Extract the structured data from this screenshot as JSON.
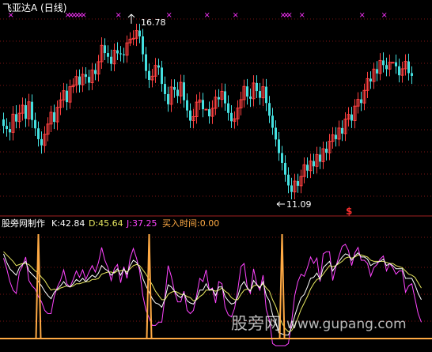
{
  "title": "飞亚达A (日线)",
  "price_panel": {
    "high_label": "16.78",
    "low_label": "11.09",
    "signal_glyph": "$",
    "marker_glyph": "×",
    "marker_color": "#ff33ff",
    "up_color": "#ff4040",
    "down_color": "#44e0e0"
  },
  "indicator_panel": {
    "source": "股旁网制作",
    "k_label": "K:42.84",
    "d_label": "D:45.64",
    "j_label": "J:37.25",
    "buy_label": "买入时间:0.00",
    "k_color": "#ffffff",
    "d_color": "#e8e860",
    "j_color": "#ff44ff",
    "buy_color": "#ffaa44"
  },
  "watermark": {
    "cn": "股旁网",
    "url": "www.gupang.com"
  },
  "chart_data": {
    "type": "candlestick",
    "price_high": 16.78,
    "price_low": 11.09,
    "marker_bars": [
      2,
      20,
      21,
      22,
      23,
      24,
      25,
      36,
      52,
      64,
      73,
      88,
      89,
      90,
      94,
      113,
      120
    ],
    "candles": [
      [
        13.68,
        13.47,
        13.9,
        13.23
      ],
      [
        13.47,
        13.37,
        13.72,
        13.12
      ],
      [
        13.37,
        13.26,
        13.6,
        13.0
      ],
      [
        13.26,
        13.85,
        14.11,
        13.0
      ],
      [
        13.85,
        13.61,
        14.14,
        13.39
      ],
      [
        13.61,
        13.88,
        14.16,
        13.39
      ],
      [
        13.88,
        14.14,
        14.39,
        13.64
      ],
      [
        14.14,
        13.7,
        14.36,
        13.43
      ],
      [
        13.7,
        14.25,
        14.51,
        13.45
      ],
      [
        14.25,
        13.66,
        14.49,
        13.4
      ],
      [
        13.66,
        13.39,
        13.9,
        13.14
      ],
      [
        13.39,
        13.04,
        13.61,
        12.8
      ],
      [
        13.04,
        12.84,
        13.29,
        12.57
      ],
      [
        12.84,
        13.2,
        13.46,
        12.6
      ],
      [
        13.2,
        13.53,
        13.75,
        12.97
      ],
      [
        13.53,
        13.91,
        14.12,
        13.27
      ],
      [
        13.91,
        13.6,
        14.16,
        13.37
      ],
      [
        13.6,
        14.07,
        14.29,
        13.33
      ],
      [
        14.07,
        14.31,
        14.56,
        13.82
      ],
      [
        14.31,
        14.61,
        14.86,
        14.06
      ],
      [
        14.61,
        14.24,
        14.84,
        13.98
      ],
      [
        14.24,
        14.74,
        14.97,
        14.02
      ],
      [
        14.74,
        14.79,
        15.01,
        14.53
      ],
      [
        14.79,
        15.07,
        15.29,
        14.54
      ],
      [
        15.07,
        14.8,
        15.3,
        14.55
      ],
      [
        14.8,
        15.14,
        15.38,
        14.57
      ],
      [
        15.14,
        15.06,
        15.37,
        14.84
      ],
      [
        15.06,
        14.87,
        15.29,
        14.62
      ],
      [
        14.87,
        15.28,
        15.51,
        14.63
      ],
      [
        15.28,
        15.15,
        15.49,
        14.95
      ],
      [
        15.15,
        15.55,
        15.77,
        14.91
      ],
      [
        15.55,
        16.08,
        16.34,
        15.32
      ],
      [
        16.08,
        15.83,
        16.31,
        15.6
      ],
      [
        15.83,
        15.71,
        16.08,
        15.5
      ],
      [
        15.71,
        15.48,
        15.94,
        15.25
      ],
      [
        15.48,
        15.92,
        16.14,
        15.24
      ],
      [
        15.92,
        15.82,
        16.18,
        15.6
      ],
      [
        15.82,
        15.79,
        16.06,
        15.56
      ],
      [
        15.79,
        15.76,
        16.0,
        15.51
      ],
      [
        15.76,
        16.16,
        16.4,
        15.52
      ],
      [
        16.16,
        16.28,
        16.5,
        16.06
      ],
      [
        16.28,
        16.31,
        16.57,
        16.08
      ],
      [
        16.31,
        16.56,
        16.78,
        16.06
      ],
      [
        16.56,
        16.37,
        16.78,
        16.15
      ],
      [
        16.37,
        15.79,
        16.61,
        15.55
      ],
      [
        15.79,
        15.25,
        16.03,
        15.0
      ],
      [
        15.25,
        14.96,
        15.49,
        14.7
      ],
      [
        14.96,
        15.08,
        15.32,
        14.72
      ],
      [
        15.08,
        15.43,
        15.67,
        14.86
      ],
      [
        15.43,
        15.36,
        15.65,
        15.12
      ],
      [
        15.36,
        14.83,
        15.58,
        14.58
      ],
      [
        14.83,
        14.5,
        15.07,
        14.27
      ],
      [
        14.5,
        14.17,
        14.74,
        13.93
      ],
      [
        14.17,
        14.73,
        14.98,
        13.92
      ],
      [
        14.73,
        14.64,
        14.98,
        14.38
      ],
      [
        14.64,
        14.44,
        14.89,
        14.21
      ],
      [
        14.44,
        14.88,
        15.13,
        14.19
      ],
      [
        14.88,
        14.3,
        15.12,
        14.06
      ],
      [
        14.3,
        13.97,
        14.52,
        13.74
      ],
      [
        13.97,
        13.64,
        14.2,
        13.4
      ],
      [
        13.64,
        13.77,
        14.02,
        13.39
      ],
      [
        13.77,
        14.24,
        14.49,
        13.54
      ],
      [
        14.24,
        14.31,
        14.57,
        13.99
      ],
      [
        14.31,
        14.01,
        14.54,
        13.75
      ],
      [
        14.01,
        14.01,
        14.01,
        14.01
      ],
      [
        14.01,
        13.78,
        14.26,
        13.54
      ],
      [
        13.78,
        14.04,
        14.3,
        13.53
      ],
      [
        14.04,
        14.4,
        14.64,
        13.82
      ],
      [
        14.4,
        14.33,
        14.66,
        14.09
      ],
      [
        14.33,
        14.59,
        14.85,
        14.08
      ],
      [
        14.59,
        14.2,
        14.84,
        13.96
      ],
      [
        14.2,
        13.89,
        14.46,
        13.64
      ],
      [
        13.89,
        13.62,
        14.14,
        13.4
      ],
      [
        13.62,
        13.7,
        13.94,
        13.38
      ],
      [
        13.7,
        14.05,
        14.3,
        13.48
      ],
      [
        14.05,
        14.32,
        14.58,
        13.81
      ],
      [
        14.32,
        14.75,
        14.97,
        14.07
      ],
      [
        14.75,
        14.42,
        14.99,
        14.16
      ],
      [
        14.42,
        14.35,
        14.68,
        14.09
      ],
      [
        14.35,
        14.86,
        15.11,
        14.1
      ],
      [
        14.86,
        14.6,
        15.11,
        14.37
      ],
      [
        14.6,
        14.38,
        14.86,
        14.15
      ],
      [
        14.38,
        14.74,
        15.0,
        14.11
      ],
      [
        14.74,
        14.21,
        14.99,
        13.95
      ],
      [
        14.21,
        13.8,
        14.44,
        13.56
      ],
      [
        13.8,
        13.41,
        14.05,
        13.18
      ],
      [
        13.41,
        13.03,
        13.65,
        12.8
      ],
      [
        13.03,
        12.59,
        13.27,
        12.34
      ],
      [
        12.59,
        12.27,
        12.82,
        12.03
      ],
      [
        12.27,
        11.89,
        12.52,
        11.66
      ],
      [
        11.89,
        11.54,
        12.13,
        11.29
      ],
      [
        11.54,
        11.33,
        11.79,
        11.09
      ],
      [
        11.33,
        11.68,
        11.92,
        11.09
      ],
      [
        11.68,
        11.53,
        11.92,
        11.3
      ],
      [
        11.53,
        11.83,
        12.05,
        11.29
      ],
      [
        11.83,
        12.21,
        12.45,
        11.61
      ],
      [
        12.21,
        12.02,
        12.45,
        11.78
      ],
      [
        12.02,
        12.33,
        12.57,
        11.78
      ],
      [
        12.33,
        12.16,
        12.57,
        11.91
      ],
      [
        12.16,
        12.54,
        12.79,
        11.93
      ],
      [
        12.54,
        12.31,
        12.79,
        12.07
      ],
      [
        12.31,
        12.73,
        12.96,
        12.07
      ],
      [
        12.73,
        12.6,
        12.96,
        12.35
      ],
      [
        12.6,
        12.97,
        13.21,
        12.36
      ],
      [
        12.97,
        13.18,
        13.43,
        12.73
      ],
      [
        13.18,
        13.04,
        13.43,
        12.8
      ],
      [
        13.04,
        13.4,
        13.64,
        12.81
      ],
      [
        13.4,
        13.22,
        13.65,
        12.98
      ],
      [
        13.22,
        13.69,
        13.91,
        12.98
      ],
      [
        13.69,
        13.84,
        14.08,
        13.45
      ],
      [
        13.84,
        13.64,
        14.09,
        13.4
      ],
      [
        13.64,
        14.11,
        14.34,
        13.39
      ],
      [
        14.11,
        14.33,
        14.56,
        13.87
      ],
      [
        14.33,
        14.21,
        14.58,
        13.95
      ],
      [
        14.21,
        14.62,
        14.84,
        13.98
      ],
      [
        14.62,
        15.0,
        15.22,
        14.37
      ],
      [
        15.0,
        14.91,
        15.24,
        14.67
      ],
      [
        14.91,
        15.31,
        15.52,
        14.67
      ],
      [
        15.31,
        15.17,
        15.57,
        14.92
      ],
      [
        15.17,
        15.59,
        15.83,
        14.95
      ],
      [
        15.59,
        15.44,
        15.85,
        15.2
      ],
      [
        15.44,
        15.31,
        15.68,
        15.08
      ],
      [
        15.31,
        15.53,
        15.78,
        15.08
      ],
      [
        15.53,
        15.53,
        15.53,
        15.53
      ],
      [
        15.53,
        15.4,
        15.78,
        15.16
      ],
      [
        15.4,
        15.11,
        15.65,
        14.88
      ],
      [
        15.11,
        15.32,
        15.55,
        14.87
      ],
      [
        15.32,
        15.56,
        15.79,
        15.1
      ],
      [
        15.56,
        15.18,
        15.81,
        14.94
      ],
      [
        15.18,
        15.09,
        15.4,
        14.83
      ]
    ],
    "indicator": {
      "K": [
        86,
        78,
        72,
        69,
        66,
        73,
        76,
        79,
        70,
        67,
        64,
        60,
        56,
        51,
        47,
        44,
        50,
        53,
        56,
        60,
        56,
        55,
        58,
        62,
        60,
        63,
        60,
        63,
        66,
        64,
        68,
        75,
        72,
        70,
        66,
        69,
        72,
        66,
        72,
        67,
        75,
        80,
        78,
        73,
        63,
        56,
        50,
        44,
        40,
        39,
        36,
        44,
        57,
        55,
        51,
        47,
        45,
        49,
        42,
        40,
        39,
        44,
        52,
        52,
        58,
        52,
        53,
        47,
        55,
        55,
        46,
        42,
        39,
        40,
        46,
        56,
        60,
        54,
        51,
        61,
        57,
        54,
        60,
        47,
        42,
        29,
        22,
        12,
        11,
        10,
        10,
        17,
        28,
        37,
        45,
        48,
        55,
        63,
        64,
        68,
        62,
        73,
        76,
        79,
        70,
        75,
        79,
        83,
        86,
        85,
        80,
        84,
        87,
        83,
        83,
        81,
        75,
        77,
        78,
        79,
        81,
        75,
        77,
        75,
        72,
        72,
        72,
        63,
        63,
        63,
        57,
        49,
        43
      ],
      "D": [
        88,
        85,
        82,
        79,
        75,
        76,
        77,
        77,
        76,
        73,
        70,
        68,
        64,
        61,
        56,
        52,
        53,
        52,
        54,
        55,
        56,
        55,
        56,
        58,
        58,
        59,
        60,
        60,
        62,
        62,
        63,
        67,
        68,
        69,
        69,
        68,
        70,
        70,
        71,
        69,
        72,
        75,
        76,
        75,
        71,
        67,
        62,
        57,
        51,
        47,
        43,
        43,
        48,
        50,
        51,
        50,
        48,
        48,
        46,
        45,
        42,
        43,
        46,
        48,
        52,
        52,
        52,
        51,
        52,
        54,
        51,
        49,
        45,
        43,
        43,
        48,
        52,
        53,
        52,
        56,
        57,
        55,
        58,
        54,
        51,
        43,
        37,
        28,
        21,
        16,
        13,
        14,
        19,
        26,
        34,
        40,
        46,
        53,
        58,
        62,
        63,
        67,
        71,
        75,
        74,
        75,
        77,
        79,
        82,
        83,
        82,
        83,
        85,
        85,
        84,
        83,
        80,
        79,
        79,
        79,
        79,
        78,
        77,
        77,
        75,
        74,
        73,
        70,
        67,
        66,
        64,
        59,
        54
      ],
      "J": [
        82,
        72,
        60,
        52,
        49,
        69,
        75,
        83,
        61,
        56,
        53,
        46,
        41,
        33,
        30,
        30,
        46,
        55,
        61,
        71,
        58,
        55,
        62,
        70,
        64,
        71,
        62,
        69,
        75,
        69,
        78,
        92,
        80,
        73,
        61,
        72,
        76,
        59,
        74,
        63,
        82,
        91,
        82,
        70,
        47,
        33,
        26,
        19,
        19,
        22,
        22,
        46,
        75,
        65,
        51,
        41,
        41,
        51,
        33,
        30,
        33,
        47,
        63,
        60,
        71,
        52,
        54,
        40,
        60,
        58,
        36,
        29,
        27,
        35,
        52,
        74,
        77,
        55,
        49,
        72,
        58,
        52,
        66,
        34,
        24,
        2,
        0,
        0,
        0,
        0,
        2,
        22,
        47,
        60,
        67,
        65,
        73,
        83,
        77,
        82,
        60,
        86,
        88,
        88,
        61,
        74,
        84,
        93,
        95,
        89,
        75,
        87,
        92,
        80,
        80,
        77,
        65,
        73,
        76,
        81,
        84,
        70,
        77,
        73,
        67,
        70,
        70,
        50,
        56,
        58,
        44,
        30,
        22
      ],
      "buy_signal_bars": [
        11,
        46,
        88
      ]
    }
  }
}
